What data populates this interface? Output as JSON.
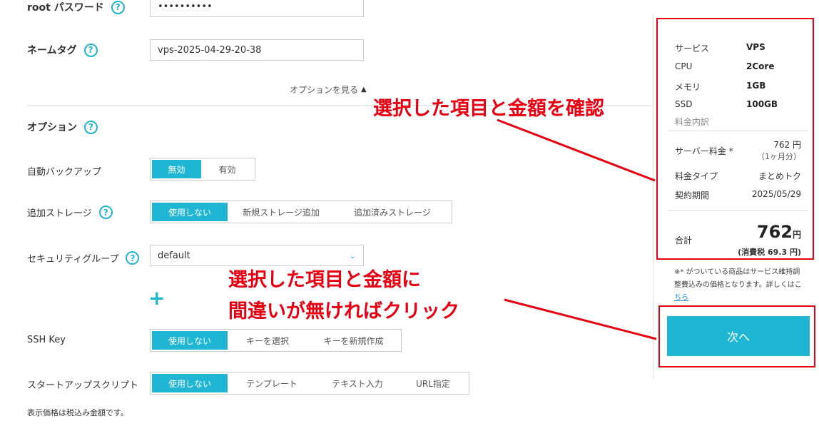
{
  "form": {
    "root_password": {
      "label": "root パスワード",
      "value": "••••••••••"
    },
    "name_tag": {
      "label": "ネームタグ",
      "value": "vps-2025-04-29-20-38"
    },
    "options_toggle": "オプションを見る",
    "options_heading": "オプション",
    "auto_backup": {
      "label": "自動バックアップ",
      "options": [
        "無効",
        "有効"
      ],
      "selected": "無効"
    },
    "storage": {
      "label": "追加ストレージ",
      "options": [
        "使用しない",
        "新規ストレージ追加",
        "追加済みストレージ"
      ],
      "selected": "使用しない"
    },
    "security_group": {
      "label": "セキュリティグループ",
      "value": "default"
    },
    "ssh_key": {
      "label": "SSH Key",
      "options": [
        "使用しない",
        "キーを選択",
        "キーを新規作成"
      ],
      "selected": "使用しない"
    },
    "startup_script": {
      "label": "スタートアップスクリプト",
      "options": [
        "使用しない",
        "テンプレート",
        "テキスト入力",
        "URL指定"
      ],
      "selected": "使用しない"
    },
    "price_note": "表示価格は税込み金額です。"
  },
  "summary": {
    "specs": [
      {
        "key": "サービス",
        "value": "VPS"
      },
      {
        "key": "CPU",
        "value": "2Core"
      },
      {
        "key": "メモリ",
        "value": "1GB"
      },
      {
        "key": "SSD",
        "value": "100GB"
      }
    ],
    "breakdown_heading": "料金内訳",
    "server_fee": {
      "label": "サーバー料金 *",
      "value": "762 円",
      "sub": "（1ヶ月分）"
    },
    "fee_type": {
      "label": "料金タイプ",
      "value": "まとめトク"
    },
    "contract_period": {
      "label": "契約期間",
      "value": "2025/05/29"
    },
    "total": {
      "label": "合計",
      "value": "762",
      "unit": "円",
      "tax": "(消費税 69.3 円)"
    }
  },
  "note": {
    "text": "※* がついている商品はサービス維持調整費込みの価格となります。詳しくはこ",
    "link": "ちら"
  },
  "next_button": "次へ",
  "annotations": {
    "confirm": "選択した項目と金額を確認",
    "click_line1": "選択した項目と金額に",
    "click_line2": "間違いが無ければクリック",
    "color": "#e60012"
  },
  "colors": {
    "accent": "#1eb6d3",
    "annotation": "#e60012"
  }
}
